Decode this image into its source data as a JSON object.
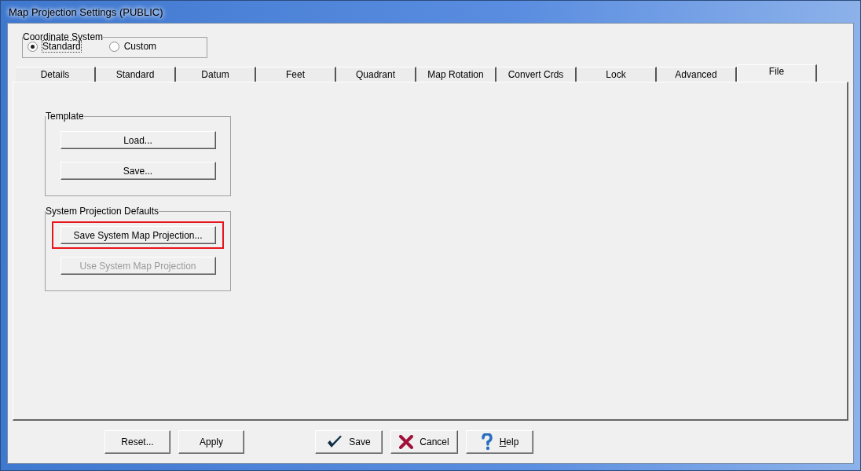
{
  "window": {
    "title": "Map Projection Settings (PUBLIC)"
  },
  "coordinate_system": {
    "title": "Coordinate System",
    "options": [
      {
        "label": "Standard",
        "selected": true
      },
      {
        "label": "Custom",
        "selected": false
      }
    ]
  },
  "tabs": [
    {
      "label": "Details",
      "selected": false
    },
    {
      "label": "Standard",
      "selected": false
    },
    {
      "label": "Datum",
      "selected": false
    },
    {
      "label": "Feet",
      "selected": false
    },
    {
      "label": "Quadrant",
      "selected": false
    },
    {
      "label": "Map Rotation",
      "selected": false
    },
    {
      "label": "Convert Crds",
      "selected": false
    },
    {
      "label": "Lock",
      "selected": false
    },
    {
      "label": "Advanced",
      "selected": false
    },
    {
      "label": "File",
      "selected": true
    }
  ],
  "groups": [
    {
      "title": "Template",
      "buttons": [
        {
          "label": "Load...",
          "disabled": false,
          "highlighted": false
        },
        {
          "label": "Save...",
          "disabled": false,
          "highlighted": false
        }
      ]
    },
    {
      "title": "System Projection Defaults",
      "buttons": [
        {
          "label": "Save System Map Projection...",
          "disabled": false,
          "highlighted": true
        },
        {
          "label": "Use System Map Projection",
          "disabled": true,
          "highlighted": false
        }
      ]
    }
  ],
  "footer_buttons": [
    {
      "label": "Reset...",
      "kind": "plain"
    },
    {
      "label": "Apply",
      "kind": "plain"
    },
    {
      "label": "Save",
      "kind": "check"
    },
    {
      "label": "Cancel",
      "kind": "cross"
    },
    {
      "label": "Help",
      "kind": "question",
      "underline_first": true
    }
  ]
}
